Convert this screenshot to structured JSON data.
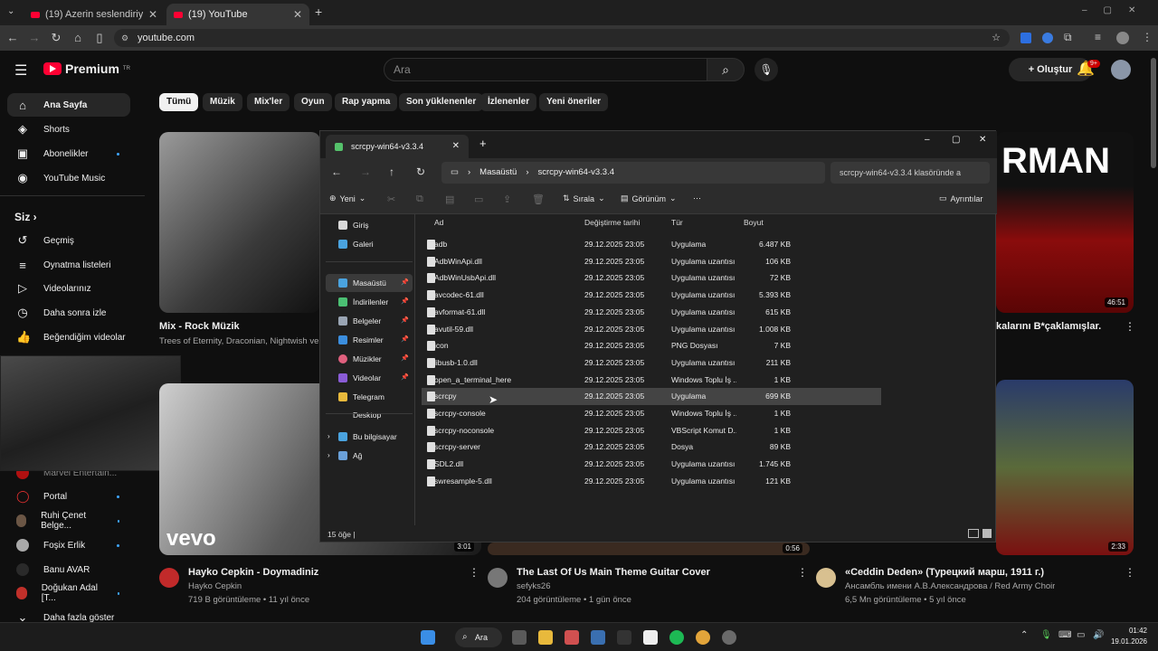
{
  "browser": {
    "tabs": [
      {
        "title": "(19) Azerin seslendiriyor \"Çırpı..."
      },
      {
        "title": "(19) YouTube"
      }
    ],
    "url": "youtube.com"
  },
  "youtube": {
    "logo": "Premium",
    "logo_sup": "TR",
    "search_placeholder": "Ara",
    "create": "Oluştur",
    "notif_count": "9+",
    "sidebar": [
      {
        "label": "Ana Sayfa",
        "icon": "home-icon"
      },
      {
        "label": "Shorts",
        "icon": "shorts-icon"
      },
      {
        "label": "Abonelikler",
        "icon": "subscriptions-icon"
      },
      {
        "label": "YouTube Music",
        "icon": "music-icon"
      }
    ],
    "you_label": "Siz",
    "you_items": [
      {
        "label": "Geçmiş",
        "icon": "history-icon"
      },
      {
        "label": "Oynatma listeleri",
        "icon": "playlist-icon"
      },
      {
        "label": "Videolarınız",
        "icon": "your-videos-icon"
      },
      {
        "label": "Daha sonra izle",
        "icon": "clock-icon"
      },
      {
        "label": "Beğendiğim videolar",
        "icon": "thumbs-up-icon"
      }
    ],
    "subs": [
      {
        "label": "Marvel Entertain..."
      },
      {
        "label": "Portal"
      },
      {
        "label": "Ruhi Çenet Belge..."
      },
      {
        "label": "Foşix Erlik"
      },
      {
        "label": "Banu AVAR"
      },
      {
        "label": "Doğukan Adal [T..."
      }
    ],
    "more": "Daha fazla göster",
    "chips": [
      "Tümü",
      "Müzik",
      "Mix'ler",
      "Oyun",
      "Rap yapma",
      "Son yüklenenler",
      "İzlenenler",
      "Yeni öneriler"
    ],
    "videos": [
      {
        "title": "Mix - Rock Müzik",
        "sub": "Trees of Eternity, Draconian, Nightwish ve d..."
      },
      {
        "title": "kalarını B*çaklamışlar.",
        "duration": "46:51",
        "overlay": "RMAN"
      },
      {
        "title": "Hayko Cepkin - Doymadiniz",
        "channel": "Hayko Cepkin",
        "stats": "719 B görüntüleme • 11 yıl önce",
        "duration": "3:01",
        "overlay": "vevo"
      },
      {
        "title": "The Last Of Us Main Theme Guitar Cover",
        "channel": "sefyks26",
        "stats": "204 görüntüleme • 1 gün önce",
        "duration": "0:56"
      },
      {
        "title": "«Ceddin Deden» (Турецкий марш, 1911 г.)",
        "channel": "Ансамбль имени А.В.Александрова / Red Army Choir",
        "stats": "6,5 Mn görüntüleme • 5 yıl önce",
        "duration": "2:33"
      }
    ]
  },
  "explorer": {
    "tab_title": "scrcpy-win64-v3.3.4",
    "breadcrumb": [
      "Masaüstü",
      "scrcpy-win64-v3.3.4"
    ],
    "search_placeholder": "scrcpy-win64-v3.3.4 klasöründe a",
    "commands": {
      "new": "Yeni",
      "sort": "Sırala",
      "view": "Görünüm",
      "details": "Ayrıntılar"
    },
    "nav": [
      {
        "label": "Giriş",
        "color": "#d9d9d9"
      },
      {
        "label": "Galeri",
        "color": "#4aa3df"
      },
      {
        "label": "Masaüstü",
        "color": "#4aa3df",
        "pinned": true
      },
      {
        "label": "İndirilenler",
        "color": "#4bbf73",
        "pinned": true
      },
      {
        "label": "Belgeler",
        "color": "#9aa5b4",
        "pinned": true
      },
      {
        "label": "Resimler",
        "color": "#3b8ede",
        "pinned": true
      },
      {
        "label": "Müzikler",
        "color": "#e0607e",
        "pinned": true
      },
      {
        "label": "Videolar",
        "color": "#8a5cd6",
        "pinned": true
      },
      {
        "label": "Telegram Desktop",
        "color": "#e8b93c"
      }
    ],
    "nav2": [
      {
        "label": "Bu bilgisayar"
      },
      {
        "label": "Ağ"
      }
    ],
    "columns": [
      "Ad",
      "Değiştirme tarihi",
      "Tür",
      "Boyut"
    ],
    "files": [
      {
        "name": "adb",
        "date": "29.12.2025 23:05",
        "type": "Uygulama",
        "size": "6.487 KB"
      },
      {
        "name": "AdbWinApi.dll",
        "date": "29.12.2025 23:05",
        "type": "Uygulama uzantısı",
        "size": "106 KB"
      },
      {
        "name": "AdbWinUsbApi.dll",
        "date": "29.12.2025 23:05",
        "type": "Uygulama uzantısı",
        "size": "72 KB"
      },
      {
        "name": "avcodec-61.dll",
        "date": "29.12.2025 23:05",
        "type": "Uygulama uzantısı",
        "size": "5.393 KB"
      },
      {
        "name": "avformat-61.dll",
        "date": "29.12.2025 23:05",
        "type": "Uygulama uzantısı",
        "size": "615 KB"
      },
      {
        "name": "avutil-59.dll",
        "date": "29.12.2025 23:05",
        "type": "Uygulama uzantısı",
        "size": "1.008 KB"
      },
      {
        "name": "icon",
        "date": "29.12.2025 23:05",
        "type": "PNG Dosyası",
        "size": "7 KB"
      },
      {
        "name": "libusb-1.0.dll",
        "date": "29.12.2025 23:05",
        "type": "Uygulama uzantısı",
        "size": "211 KB"
      },
      {
        "name": "open_a_terminal_here",
        "date": "29.12.2025 23:05",
        "type": "Windows Toplu İş ...",
        "size": "1 KB"
      },
      {
        "name": "scrcpy",
        "date": "29.12.2025 23:05",
        "type": "Uygulama",
        "size": "699 KB",
        "selected": true
      },
      {
        "name": "scrcpy-console",
        "date": "29.12.2025 23:05",
        "type": "Windows Toplu İş ...",
        "size": "1 KB"
      },
      {
        "name": "scrcpy-noconsole",
        "date": "29.12.2025 23:05",
        "type": "VBScript Komut D...",
        "size": "1 KB"
      },
      {
        "name": "scrcpy-server",
        "date": "29.12.2025 23:05",
        "type": "Dosya",
        "size": "89 KB"
      },
      {
        "name": "SDL2.dll",
        "date": "29.12.2025 23:05",
        "type": "Uygulama uzantısı",
        "size": "1.745 KB"
      },
      {
        "name": "swresample-5.dll",
        "date": "29.12.2025 23:05",
        "type": "Uygulama uzantısı",
        "size": "121 KB"
      }
    ],
    "status": "15 öğe"
  },
  "taskbar": {
    "search": "Ara",
    "time": "01:42",
    "date": "19.01.2026"
  }
}
